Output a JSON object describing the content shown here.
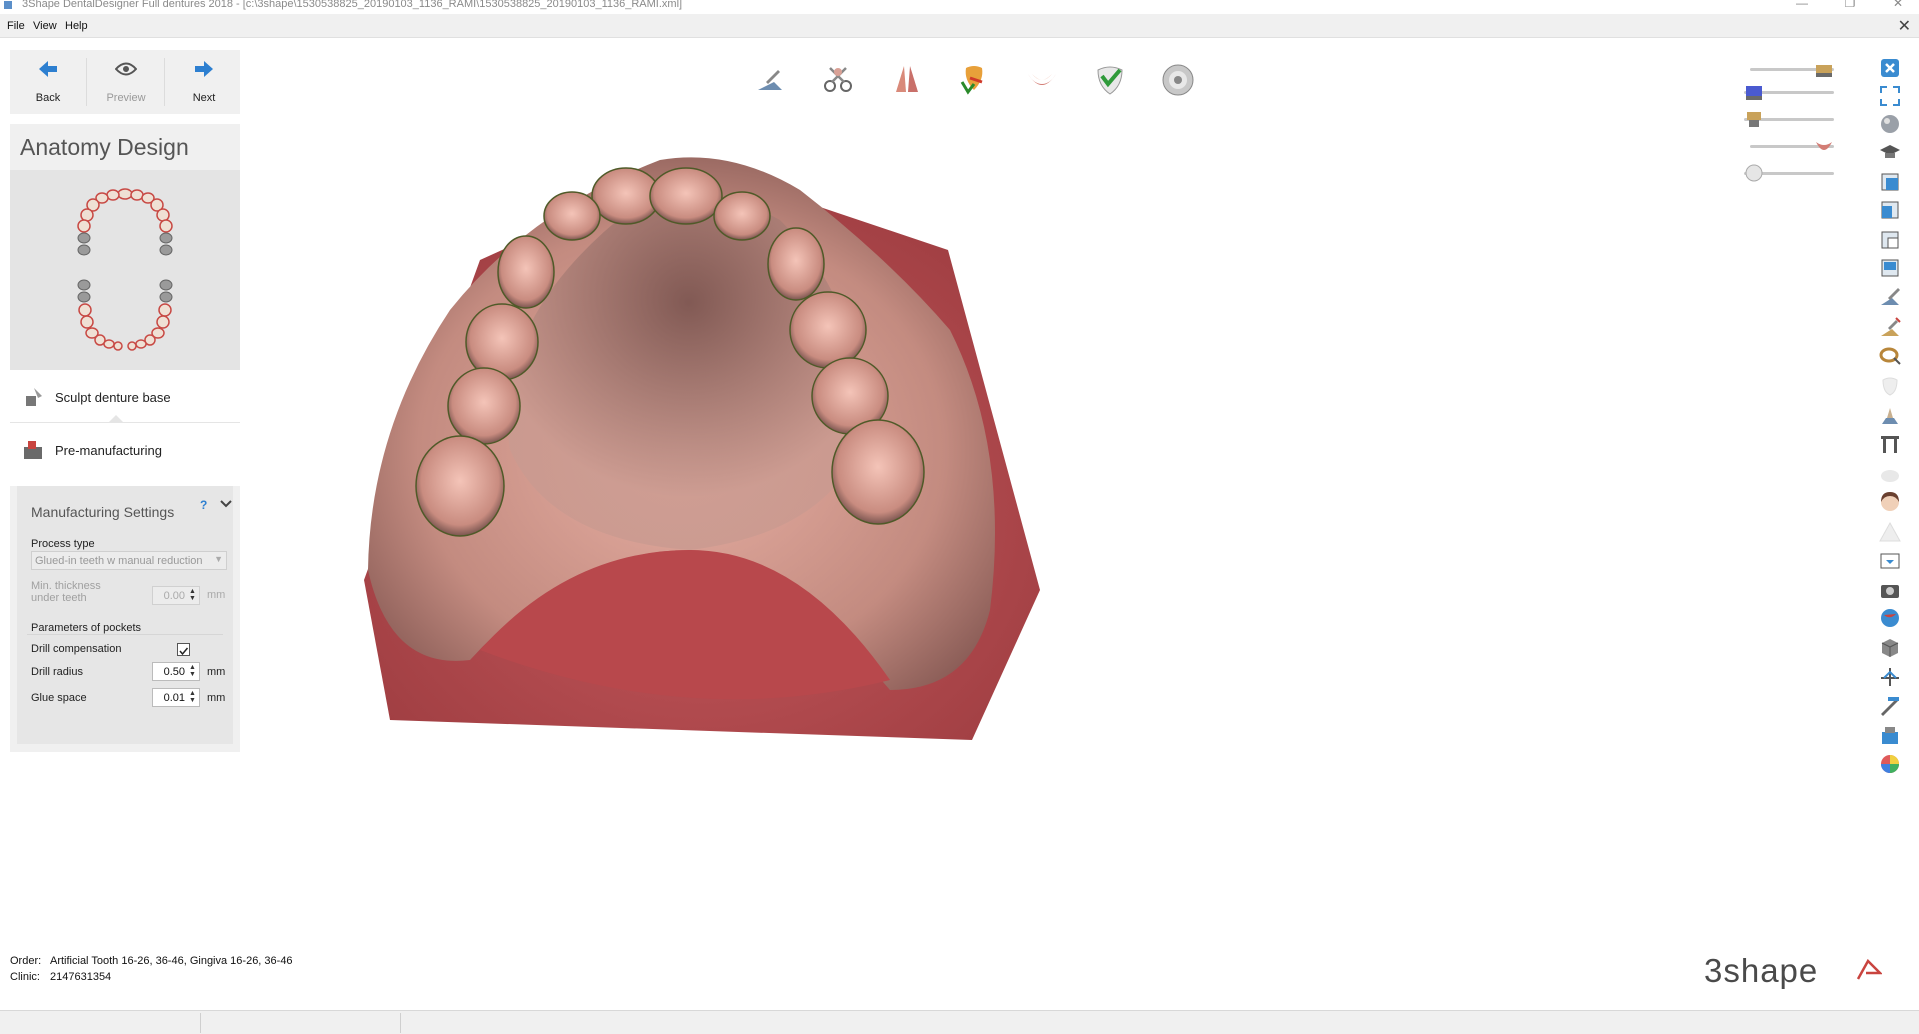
{
  "window": {
    "title": "3Shape DentalDesigner Full dentures 2018 - [c:\\3shape\\1530538825_20190103_1136_RAMI\\1530538825_20190103_1136_RAMI.xml]",
    "min_glyph": "—",
    "max_glyph": "❐",
    "close_glyph": "✕"
  },
  "menu": {
    "items": [
      "File",
      "View",
      "Help"
    ],
    "close_glyph": "✕"
  },
  "nav": {
    "back": "Back",
    "preview": "Preview",
    "next": "Next"
  },
  "panel": {
    "title": "Anatomy Design",
    "steps": [
      {
        "label": "Sculpt denture base",
        "icon": "sculpt-icon"
      },
      {
        "label": "Pre-manufacturing",
        "icon": "pre-manufacturing-icon"
      }
    ]
  },
  "manufacturing": {
    "header": "Manufacturing Settings",
    "help": "?",
    "process_type_label": "Process type",
    "process_type_value": "Glued-in teeth w manual reduction",
    "min_thickness_label_1": "Min. thickness",
    "min_thickness_label_2": "under teeth",
    "min_thickness_value": "0.00",
    "pockets_label": "Parameters of pockets",
    "drill_comp_label": "Drill compensation",
    "drill_comp_checked": true,
    "drill_radius_label": "Drill radius",
    "drill_radius_value": "0.50",
    "glue_space_label": "Glue space",
    "glue_space_value": "0.01",
    "unit": "mm"
  },
  "toolbar": {
    "tools": [
      "carve-icon",
      "scissors-icon",
      "tooth-split-icon",
      "tooth-arrow-icon",
      "gingiva-icon",
      "tooth-check-icon",
      "disc-icon"
    ]
  },
  "visibility_sliders": [
    {
      "name": "upper-model-slider",
      "level": 1.0
    },
    {
      "name": "lower-model-slider",
      "level": 0.0
    },
    {
      "name": "teeth-slider",
      "level": 0.0
    },
    {
      "name": "gingiva-slider",
      "level": 1.0
    },
    {
      "name": "tooth-library-slider",
      "level": 0.0
    }
  ],
  "right_tools": [
    "close-view-icon",
    "fit-view-icon",
    "sphere-view-icon",
    "cap-icon",
    "cube-front-icon",
    "cube-side-icon",
    "cube-back-icon",
    "cube-top-icon",
    "knife-icon",
    "knife-up-icon",
    "ring-icon",
    "tooth-faded-icon",
    "stage-icon",
    "panel-icon",
    "crown-faded-icon",
    "face-icon",
    "warning-icon",
    "screen-icon",
    "camera-icon",
    "globe-icon",
    "box-icon",
    "axis-icon",
    "pen-icon",
    "scanner-icon",
    "color-wheel-icon"
  ],
  "footer": {
    "order_label": "Order:",
    "order_value": "Artificial Tooth 16-26, 36-46, Gingiva 16-26, 36-46",
    "clinic_label": "Clinic:",
    "clinic_value": "2147631354"
  },
  "brand": {
    "logo_text": "3shape"
  },
  "colors": {
    "accent": "#2d7fd0",
    "gum": "#b8484c",
    "denture": "#d9a196",
    "panel": "#f0f0f0"
  }
}
